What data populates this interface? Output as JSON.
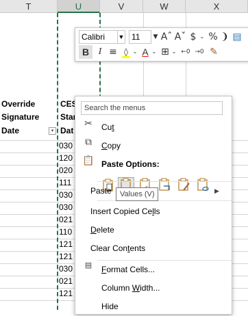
{
  "columns": [
    {
      "id": "T",
      "label": "T"
    },
    {
      "id": "U",
      "label": "U"
    },
    {
      "id": "V",
      "label": "V"
    },
    {
      "id": "W",
      "label": "W"
    },
    {
      "id": "X",
      "label": "X"
    }
  ],
  "headers": {
    "t_line1": "Override",
    "t_line2": "Signature",
    "t_line3": "Date",
    "u_line1": "CES",
    "u_line2": "Star",
    "u_line3": "Dat"
  },
  "u_values": [
    "030",
    "120",
    "020",
    "111",
    "030",
    "030",
    "021",
    "110",
    "121",
    "121",
    "030",
    "021",
    "121"
  ],
  "mini_toolbar": {
    "font_name": "Calibri",
    "font_size": "11",
    "grow_font": "Aˆ",
    "shrink_font": "Aˇ",
    "currency": "$",
    "percent": "%",
    "comma": ")",
    "bold": "B",
    "italic": "I",
    "align": "≡",
    "fill_color": "#FFFF00",
    "font_color": "#FF0000"
  },
  "menu": {
    "search_placeholder": "Search the menus",
    "cut": "Cut",
    "copy": "Copy",
    "paste_options": "Paste Options:",
    "paste_special": "Paste",
    "insert_copied": "Insert Copied Cells",
    "delete": "Delete",
    "clear_contents": "Clear Contents",
    "format_cells": "Format Cells...",
    "column_width": "Column Width...",
    "hide": "Hide"
  },
  "tooltip": "Values (V)",
  "paste_icons": [
    "paste",
    "paste-values",
    "paste-formulas",
    "paste-transpose",
    "paste-formatting",
    "paste-link"
  ],
  "colors": {
    "accent": "#217346",
    "icon_green": "#e8a24a"
  }
}
